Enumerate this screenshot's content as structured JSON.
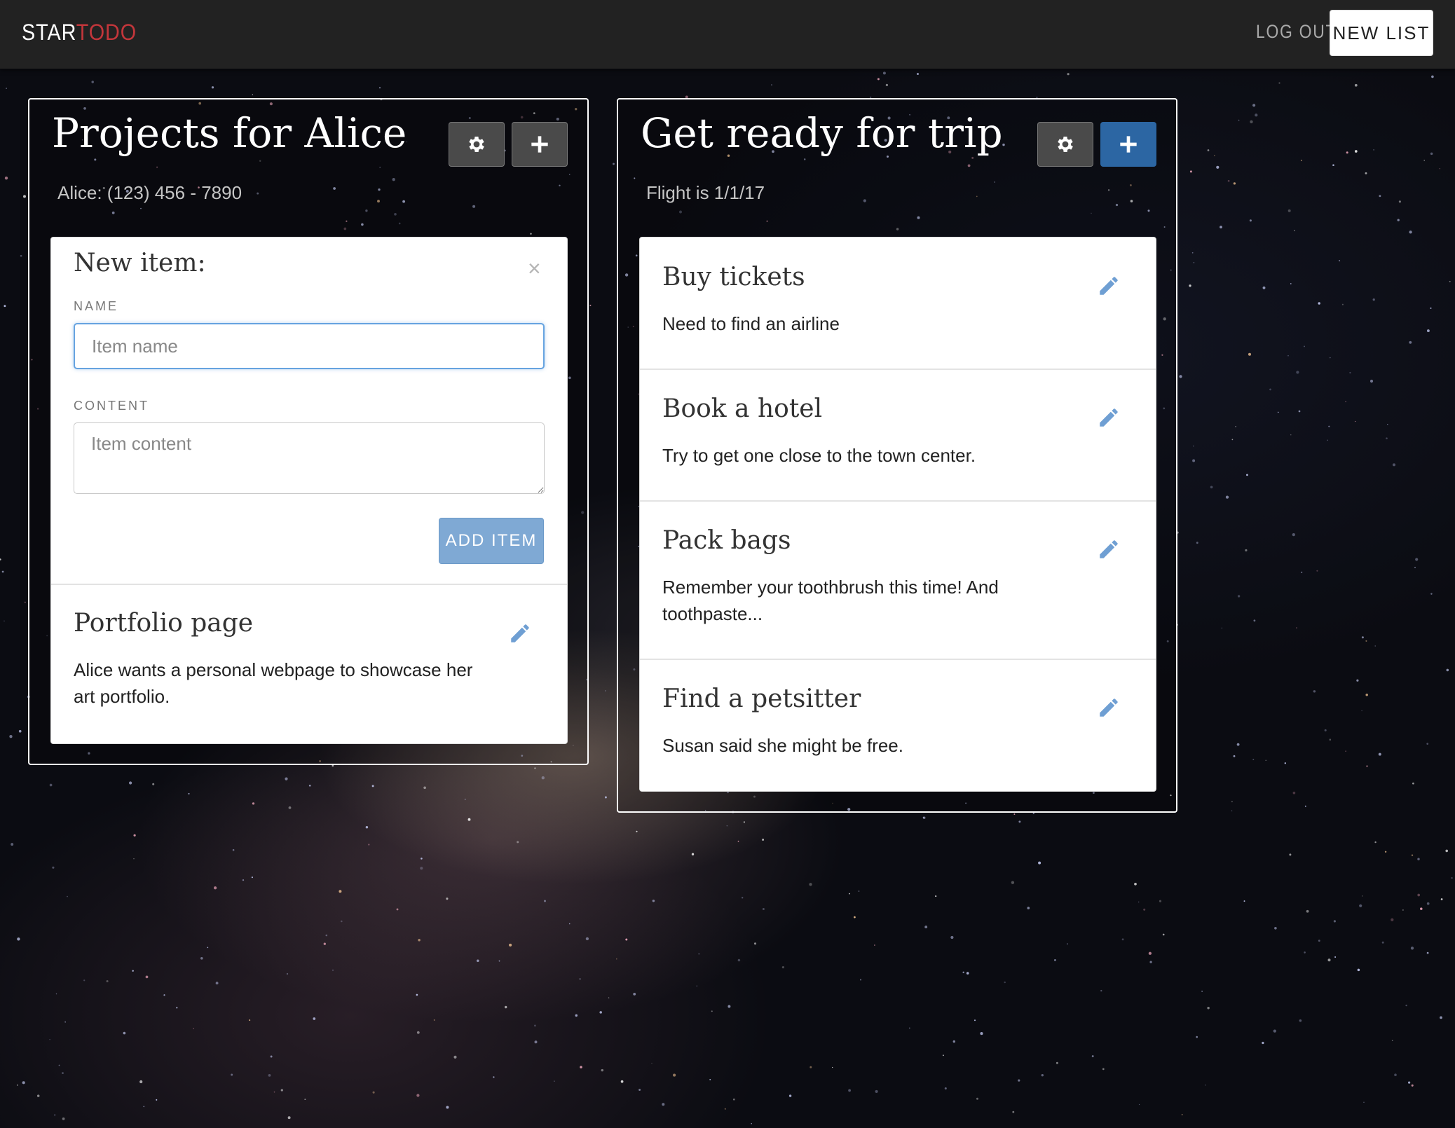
{
  "navbar": {
    "brand_part1": "STAR",
    "brand_part2": "TODO",
    "logout_label": "LOG OUT",
    "new_list_label": "NEW LIST"
  },
  "lists": [
    {
      "title": "Projects for Alice",
      "subtitle": "Alice: (123) 456 - 7890",
      "settings_icon": "gear-icon",
      "add_icon": "plus-icon",
      "new_item_form": {
        "title": "New item:",
        "close_glyph": "×",
        "name_label": "NAME",
        "name_placeholder": "Item name",
        "content_label": "CONTENT",
        "content_placeholder": "Item content",
        "submit_label": "ADD ITEM"
      },
      "items": [
        {
          "title": "Portfolio page",
          "content": "Alice wants a personal webpage to showcase her art portfolio."
        }
      ]
    },
    {
      "title": "Get ready for trip",
      "subtitle": "Flight is 1/1/17",
      "settings_icon": "gear-icon",
      "add_icon": "plus-icon",
      "items": [
        {
          "title": "Buy tickets",
          "content": "Need to find an airline"
        },
        {
          "title": "Book a hotel",
          "content": "Try to get one close to the town center."
        },
        {
          "title": "Pack bags",
          "content": "Remember your toothbrush this time! And toothpaste..."
        },
        {
          "title": "Find a petsitter",
          "content": "Susan said she might be free."
        }
      ]
    }
  ],
  "colors": {
    "navbar_bg": "#222222",
    "brand_accent": "#c3363b",
    "primary_blue": "#2c66a3",
    "add_item_button": "#7fa9d4",
    "edit_icon": "#6f9fd3"
  }
}
